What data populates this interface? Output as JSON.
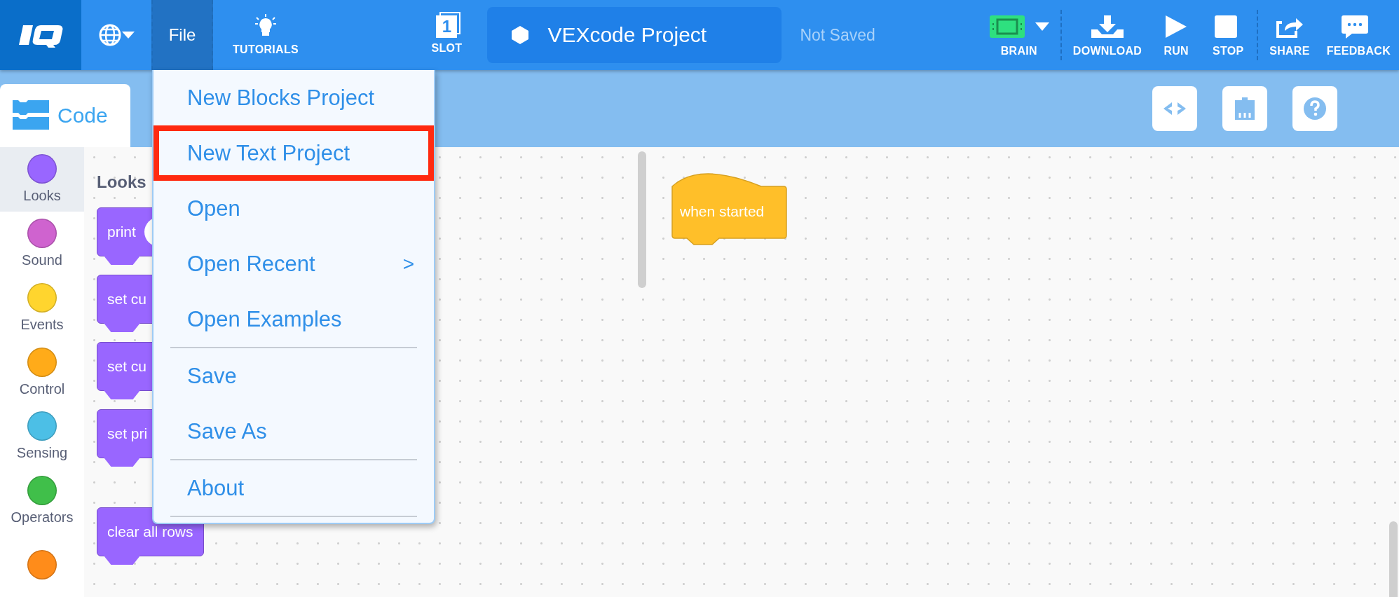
{
  "top_bar": {
    "file_menu": {
      "label": "File",
      "open": true
    },
    "tutorials": {
      "label": "TUTORIALS"
    },
    "slot": {
      "number": "1",
      "label": "SLOT"
    },
    "project_name": "VEXcode Project",
    "save_status": "Not Saved",
    "tool_groups": [
      [
        {
          "label": "BRAIN",
          "dropdown": true
        }
      ],
      [
        {
          "label": "DOWNLOAD",
          "dropdown": false
        },
        {
          "label": "RUN",
          "dropdown": false
        },
        {
          "label": "STOP",
          "dropdown": false
        }
      ],
      [
        {
          "label": "SHARE",
          "dropdown": false
        },
        {
          "label": "FEEDBACK",
          "dropdown": false
        }
      ]
    ]
  },
  "tab": {
    "label": "Code",
    "selected": true
  },
  "categories": [
    {
      "name": "Looks",
      "color": "#9966ff",
      "selected": true
    },
    {
      "name": "Sound",
      "color": "#cf63cf",
      "selected": false
    },
    {
      "name": "Events",
      "color": "#ffd52e",
      "selected": false
    },
    {
      "name": "Control",
      "color": "#ffab19",
      "selected": false
    },
    {
      "name": "Sensing",
      "color": "#4cbfe6",
      "selected": false
    },
    {
      "name": "Operators",
      "color": "#40bf4a",
      "selected": false
    },
    {
      "color": "#ff8c1a",
      "selected": false
    }
  ],
  "palette": {
    "heading": "Looks",
    "blocks": [
      {
        "label": "print",
        "input": true
      },
      {
        "label": "set cu",
        "input": false
      },
      {
        "label": "set cu",
        "input": false
      },
      {
        "label": "set pri",
        "input": false
      },
      {
        "label": "clear all rows",
        "input": false
      }
    ]
  },
  "workspace": {
    "blocks": [
      {
        "label": "when started",
        "kind": "hat"
      }
    ]
  },
  "file_menu": [
    {
      "kind": "item",
      "label": "New Blocks Project",
      "highlighted": false
    },
    {
      "kind": "item",
      "label": "New Text Project",
      "highlighted": true
    },
    {
      "kind": "item",
      "label": "Open",
      "highlighted": false
    },
    {
      "kind": "item",
      "label": "Open Recent",
      "highlighted": false,
      "arrow": ">"
    },
    {
      "kind": "item",
      "label": "Open Examples",
      "highlighted": false
    },
    {
      "kind": "divider"
    },
    {
      "kind": "item",
      "label": "Save",
      "highlighted": false
    },
    {
      "kind": "item",
      "label": "Save As",
      "highlighted": false
    },
    {
      "kind": "divider"
    },
    {
      "kind": "item",
      "label": "About",
      "highlighted": false
    },
    {
      "kind": "divider"
    }
  ]
}
